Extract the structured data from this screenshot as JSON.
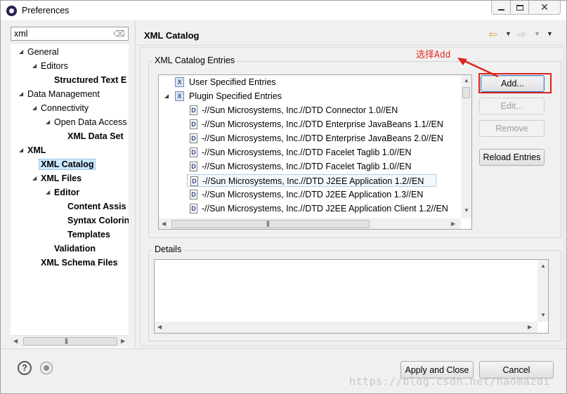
{
  "window": {
    "title": "Preferences"
  },
  "filter": {
    "value": "xml"
  },
  "tree": [
    {
      "label": "General",
      "level": 0,
      "arrow": "◢",
      "bold": false
    },
    {
      "label": "Editors",
      "level": 1,
      "arrow": "◢",
      "bold": false
    },
    {
      "label": "Structured Text E",
      "level": 2,
      "arrow": "",
      "bold": true
    },
    {
      "label": "Data Management",
      "level": 0,
      "arrow": "◢",
      "bold": false
    },
    {
      "label": "Connectivity",
      "level": 1,
      "arrow": "◢",
      "bold": false
    },
    {
      "label": "Open Data Access",
      "level": 2,
      "arrow": "◢",
      "bold": false
    },
    {
      "label": "XML Data Set",
      "level": 3,
      "arrow": "",
      "bold": true
    },
    {
      "label": "XML",
      "level": 0,
      "arrow": "◢",
      "bold": true
    },
    {
      "label": "XML Catalog",
      "level": 1,
      "arrow": "",
      "bold": true,
      "selected": true
    },
    {
      "label": "XML Files",
      "level": 1,
      "arrow": "◢",
      "bold": true
    },
    {
      "label": "Editor",
      "level": 2,
      "arrow": "◢",
      "bold": true
    },
    {
      "label": "Content Assis",
      "level": 3,
      "arrow": "",
      "bold": true
    },
    {
      "label": "Syntax Colorin",
      "level": 3,
      "arrow": "",
      "bold": true
    },
    {
      "label": "Templates",
      "level": 3,
      "arrow": "",
      "bold": true
    },
    {
      "label": "Validation",
      "level": 2,
      "arrow": "",
      "bold": true
    },
    {
      "label": "XML Schema Files",
      "level": 1,
      "arrow": "",
      "bold": true
    }
  ],
  "page": {
    "title": "XML Catalog"
  },
  "entries": {
    "label": "XML Catalog Entries",
    "rows": [
      {
        "label": "User Specified Entries",
        "type": "group",
        "arrow": ""
      },
      {
        "label": "Plugin Specified Entries",
        "type": "group",
        "arrow": "◢"
      },
      {
        "label": "-//Sun Microsystems, Inc.//DTD Connector 1.0//EN",
        "type": "dtd"
      },
      {
        "label": "-//Sun Microsystems, Inc.//DTD Enterprise JavaBeans 1.1//EN",
        "type": "dtd"
      },
      {
        "label": "-//Sun Microsystems, Inc.//DTD Enterprise JavaBeans 2.0//EN",
        "type": "dtd"
      },
      {
        "label": "-//Sun Microsystems, Inc.//DTD Facelet Taglib 1.0//EN",
        "type": "dtd"
      },
      {
        "label": "-//Sun Microsystems, Inc.//DTD Facelet Taglib 1.0//EN",
        "type": "dtd"
      },
      {
        "label": "-//Sun Microsystems, Inc.//DTD J2EE Application 1.2//EN",
        "type": "dtd",
        "selected": true
      },
      {
        "label": "-//Sun Microsystems, Inc.//DTD J2EE Application 1.3//EN",
        "type": "dtd"
      },
      {
        "label": "-//Sun Microsystems, Inc.//DTD J2EE Application Client 1.2//EN",
        "type": "dtd"
      }
    ]
  },
  "buttons": {
    "add": "Add...",
    "edit": "Edit...",
    "remove": "Remove",
    "reload": "Reload Entries",
    "apply_close": "Apply and Close",
    "cancel": "Cancel"
  },
  "annotation": {
    "text": "选择Add",
    "color": "#e8312c"
  },
  "details": {
    "label": "Details"
  },
  "watermark": "https://blog.csdn.net/haomazdi",
  "colors": {
    "selection": "#cce8ff",
    "annotation_red": "#e0211d"
  }
}
